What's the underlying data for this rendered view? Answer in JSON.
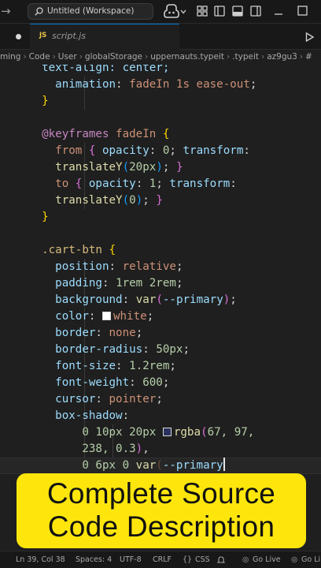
{
  "titlebar": {
    "back_icon": "arrow-left-icon",
    "forward_icon": "arrow-right-icon",
    "search_text": "Untitled (Workspace)"
  },
  "tab": {
    "language_badge": "JS",
    "file_name": "script.js"
  },
  "breadcrumb": [
    "ming",
    "Code",
    "User",
    "globalStorage",
    "uppernauts.typeit",
    ".typeit",
    "az9gu3",
    "#"
  ],
  "editor": {
    "lines": [
      [
        [
          "  text-align: center;",
          "t-prop"
        ]
      ],
      [
        [
          "    animation",
          "t-prop"
        ],
        [
          ": ",
          "t-punc"
        ],
        [
          "fadeIn 1s ease-out",
          "t-val"
        ],
        [
          ";",
          "t-punc"
        ]
      ],
      [
        [
          "  }",
          "t-br1"
        ]
      ],
      [
        [
          "",
          ""
        ]
      ],
      [
        [
          "  @keyframes",
          "t-at"
        ],
        [
          " fadeIn ",
          "t-val"
        ],
        [
          "{",
          "t-br1"
        ]
      ],
      [
        [
          "    from ",
          "t-val"
        ],
        [
          "{ ",
          "t-br2"
        ],
        [
          "opacity",
          "t-prop"
        ],
        [
          ": ",
          "t-punc"
        ],
        [
          "0",
          "t-num"
        ],
        [
          "; ",
          "t-punc"
        ],
        [
          "transform",
          "t-prop"
        ],
        [
          ":",
          "t-punc"
        ]
      ],
      [
        [
          "    ",
          "t-punc"
        ],
        [
          "translateY",
          "t-fn"
        ],
        [
          "(",
          "t-br3"
        ],
        [
          "20px",
          "t-num"
        ],
        [
          ")",
          "t-br3"
        ],
        [
          "; ",
          "t-punc"
        ],
        [
          "}",
          "t-br2"
        ]
      ],
      [
        [
          "    to ",
          "t-val"
        ],
        [
          "{ ",
          "t-br2"
        ],
        [
          "opacity",
          "t-prop"
        ],
        [
          ": ",
          "t-punc"
        ],
        [
          "1",
          "t-num"
        ],
        [
          "; ",
          "t-punc"
        ],
        [
          "transform",
          "t-prop"
        ],
        [
          ":",
          "t-punc"
        ]
      ],
      [
        [
          "    ",
          "t-punc"
        ],
        [
          "translateY",
          "t-fn"
        ],
        [
          "(",
          "t-br3"
        ],
        [
          "0",
          "t-num"
        ],
        [
          ")",
          "t-br3"
        ],
        [
          "; ",
          "t-punc"
        ],
        [
          "}",
          "t-br2"
        ]
      ],
      [
        [
          "  }",
          "t-br1"
        ]
      ],
      [
        [
          "",
          ""
        ]
      ],
      [
        [
          "  .cart-btn ",
          "t-sel"
        ],
        [
          "{",
          "t-br1"
        ]
      ],
      [
        [
          "    position",
          "t-prop"
        ],
        [
          ": ",
          "t-punc"
        ],
        [
          "relative",
          "t-val"
        ],
        [
          ";",
          "t-punc"
        ]
      ],
      [
        [
          "    padding",
          "t-prop"
        ],
        [
          ": ",
          "t-punc"
        ],
        [
          "1rem 2rem",
          "t-num"
        ],
        [
          ";",
          "t-punc"
        ]
      ],
      [
        [
          "    background",
          "t-prop"
        ],
        [
          ": ",
          "t-punc"
        ],
        [
          "var",
          "t-fn"
        ],
        [
          "(",
          "t-br2"
        ],
        [
          "--primary",
          "t-var"
        ],
        [
          ")",
          "t-br2"
        ],
        [
          ";",
          "t-punc"
        ]
      ],
      [
        [
          "    color",
          "t-prop"
        ],
        [
          ": ",
          "t-punc"
        ],
        [
          "SWATCH_WHITE",
          ""
        ],
        [
          "white",
          "t-val"
        ],
        [
          ";",
          "t-punc"
        ]
      ],
      [
        [
          "    border",
          "t-prop"
        ],
        [
          ": ",
          "t-punc"
        ],
        [
          "none",
          "t-val"
        ],
        [
          ";",
          "t-punc"
        ]
      ],
      [
        [
          "    border-radius",
          "t-prop"
        ],
        [
          ": ",
          "t-punc"
        ],
        [
          "50px",
          "t-num"
        ],
        [
          ";",
          "t-punc"
        ]
      ],
      [
        [
          "    font-size",
          "t-prop"
        ],
        [
          ": ",
          "t-punc"
        ],
        [
          "1.2rem",
          "t-num"
        ],
        [
          ";",
          "t-punc"
        ]
      ],
      [
        [
          "    font-weight",
          "t-prop"
        ],
        [
          ": ",
          "t-punc"
        ],
        [
          "600",
          "t-num"
        ],
        [
          ";",
          "t-punc"
        ]
      ],
      [
        [
          "    cursor",
          "t-prop"
        ],
        [
          ": ",
          "t-punc"
        ],
        [
          "pointer",
          "t-val"
        ],
        [
          ";",
          "t-punc"
        ]
      ],
      [
        [
          "    box-shadow",
          "t-prop"
        ],
        [
          ":",
          "t-punc"
        ]
      ],
      [
        [
          "        0 10px 20px ",
          "t-num"
        ],
        [
          "SWATCH_DARK",
          ""
        ],
        [
          "rgba",
          "t-fn"
        ],
        [
          "(",
          "t-br2"
        ],
        [
          "67, 97,",
          "t-num"
        ]
      ],
      [
        [
          "        238, 0.3",
          "t-num"
        ],
        [
          ")",
          "t-br2"
        ],
        [
          ",",
          "t-punc"
        ]
      ],
      [
        [
          "        0 6px 0 ",
          "t-num"
        ],
        [
          "var",
          "t-fn"
        ],
        [
          "(",
          "t-dim"
        ],
        [
          "--primary",
          "t-var"
        ],
        [
          "CURSOR",
          ""
        ]
      ]
    ],
    "cursor_line": 24
  },
  "banner": {
    "line1": "Complete Source",
    "line2": "Code Description",
    "color": "#fee60c"
  },
  "statusbar": {
    "position": "Ln 39, Col 38",
    "spaces": "Spaces: 4",
    "encoding": "UTF-8",
    "eol": "CRLF",
    "language": "CSS",
    "golive1": "Go Live",
    "golive2": "Go Li"
  },
  "colors": {
    "accent": "#0078d4",
    "editor_bg": "#1f1f1f",
    "chrome_bg": "#181818"
  }
}
